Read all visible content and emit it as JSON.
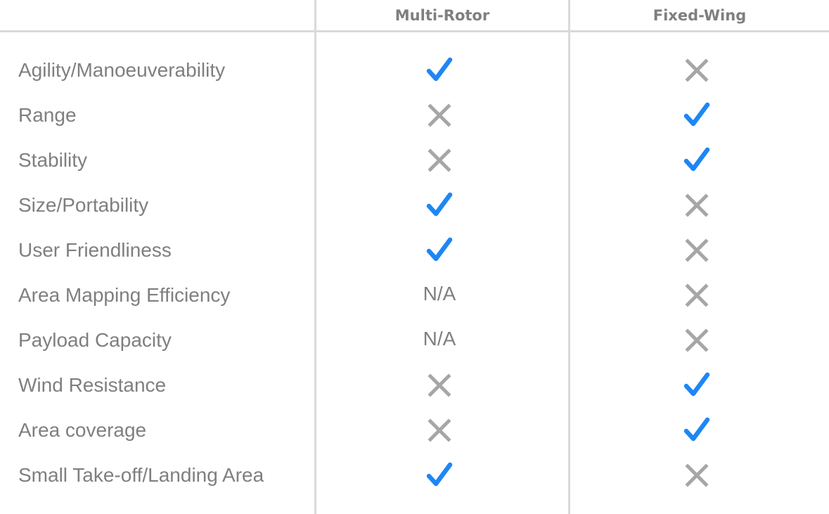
{
  "columns": [
    "Multi-Rotor",
    "Fixed-Wing"
  ],
  "rows": [
    {
      "label": "Agility/Manoeuverability",
      "values": [
        "check",
        "cross"
      ]
    },
    {
      "label": "Range",
      "values": [
        "cross",
        "check"
      ]
    },
    {
      "label": "Stability",
      "values": [
        "cross",
        "check"
      ]
    },
    {
      "label": "Size/Portability",
      "values": [
        "check",
        "cross"
      ]
    },
    {
      "label": "User Friendliness",
      "values": [
        "check",
        "cross"
      ]
    },
    {
      "label": "Area Mapping Efficiency",
      "values": [
        "N/A",
        "cross"
      ]
    },
    {
      "label": "Payload Capacity",
      "values": [
        "N/A",
        "cross"
      ]
    },
    {
      "label": "Wind Resistance",
      "values": [
        "cross",
        "check"
      ]
    },
    {
      "label": "Area coverage",
      "values": [
        "cross",
        "check"
      ]
    },
    {
      "label": "Small Take-off/Landing Area",
      "values": [
        "check",
        "cross"
      ]
    }
  ],
  "colors": {
    "check": "#1e86f5",
    "cross": "#a6a6a6",
    "text": "#7f7f7f",
    "grid": "#d9d9d9"
  }
}
